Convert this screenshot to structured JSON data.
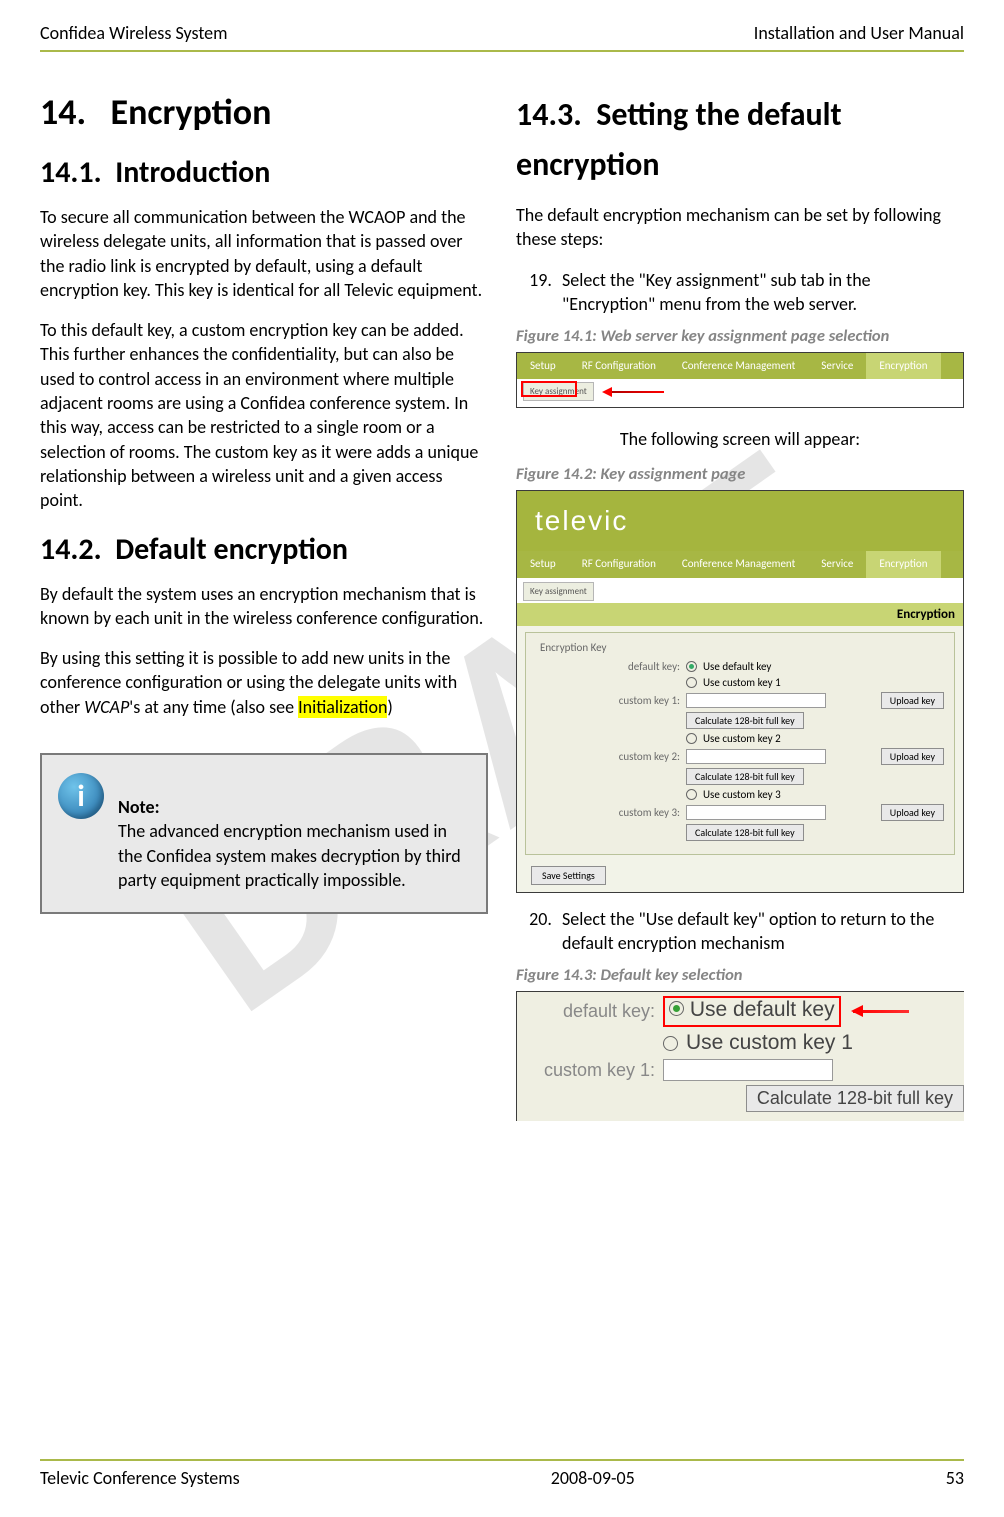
{
  "header": {
    "left": "Confidea Wireless System",
    "right": "Installation and User Manual"
  },
  "footer": {
    "left": "Televic Conference Systems",
    "center": "2008-09-05",
    "right": "53"
  },
  "watermark": "DRAFT",
  "left": {
    "chapter_num": "14.",
    "chapter_title": "Encryption",
    "s1_num": "14.1.",
    "s1_title": "Introduction",
    "s1_p1": "To secure all communication between the WCAOP and the wireless delegate units, all information that is passed over the radio link is encrypted by default, using a default encryption key. This key is identical for all Televic equipment.",
    "s1_p2": "To this default key, a custom encryption key can be added. This further enhances the confidentiality, but can also be used to control access in an environment where multiple adjacent rooms are using a Confidea conference system. In this way, access can be restricted to a single room or a selection of rooms. The custom key as it were adds a unique relationship between a wireless unit and a given access point.",
    "s2_num": "14.2.",
    "s2_title": "Default encryption",
    "s2_p1": "By default the system uses an encryption mechanism that is known by each unit in the wireless conference configuration.",
    "s2_p2a": "By using this setting it is possible to add new units in the conference configuration or using the delegate units with other ",
    "s2_p2b": "WCAP",
    "s2_p2c": "'s at any time (also see ",
    "s2_p2d": "Initialization",
    "s2_p2e": ")",
    "note_title": "Note:",
    "note_body": "The advanced encryption mechanism used in the Confidea system makes decryption by third party equipment practically impossible."
  },
  "right": {
    "s3_num": "14.3.",
    "s3_title": "Setting the default encryption",
    "s3_p1": "The default encryption mechanism can be set by following these steps:",
    "step19": "Select the \"Key assignment\" sub tab in the \"Encryption\" menu from the web server.",
    "fig1_cap": "Figure 14.1: Web server key assignment page selection",
    "tabs": {
      "setup": "Setup",
      "rf": "RF Configuration",
      "conf": "Conference Management",
      "service": "Service",
      "enc": "Encryption"
    },
    "subtab": "Key assignment",
    "mid_text": "The following screen will appear:",
    "fig2_cap": "Figure 14.2: Key assignment page",
    "logo": "televic",
    "enc_heading": "Encryption",
    "fieldset_legend": "Encryption Key",
    "labels": {
      "default_key": "default key:",
      "custom1": "custom key 1:",
      "custom2": "custom key 2:",
      "custom3": "custom key 3:"
    },
    "options": {
      "use_default": "Use default key",
      "use_c1": "Use custom key 1",
      "use_c2": "Use custom key 2",
      "use_c3": "Use custom key 3"
    },
    "buttons": {
      "calc": "Calculate 128-bit full key",
      "upload": "Upload key",
      "save": "Save Settings"
    },
    "step20": "Select the \"Use default key\" option to return to the default encryption mechanism",
    "fig3_cap": "Figure 14.3: Default key selection"
  }
}
